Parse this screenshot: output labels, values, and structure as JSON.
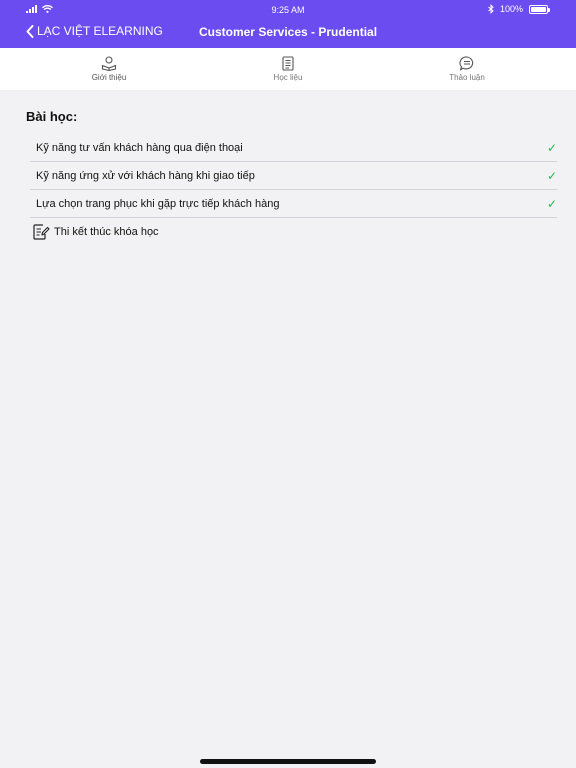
{
  "status_bar": {
    "time": "9:25 AM",
    "battery": "100%",
    "battery_level": 1.0
  },
  "nav": {
    "back_label": "LẠC VIỆT ELEARNING",
    "title": "Customer Services - Prudential"
  },
  "tabs": [
    {
      "label": "Giới thiệu",
      "icon": "reader-icon",
      "active": true
    },
    {
      "label": "Học liệu",
      "icon": "document-icon",
      "active": false
    },
    {
      "label": "Thảo luận",
      "icon": "chat-bubble-icon",
      "active": false
    }
  ],
  "lessons_title": "Bài học:",
  "lessons": [
    {
      "title": "Kỹ năng tư vấn khách hàng qua điện thoại",
      "check": "✓"
    },
    {
      "title": "Kỹ năng ứng xử với khách hàng khi giao tiếp",
      "check": "✓"
    },
    {
      "title": "Lựa chọn trang phục khi gặp trực tiếp khách hàng",
      "check": "✓"
    }
  ],
  "final_exam": {
    "label": "Thi kết thúc khóa học",
    "icon": "exam-edit-icon"
  },
  "colors": {
    "header": "#6a4cf0",
    "check": "#2ab34a"
  }
}
